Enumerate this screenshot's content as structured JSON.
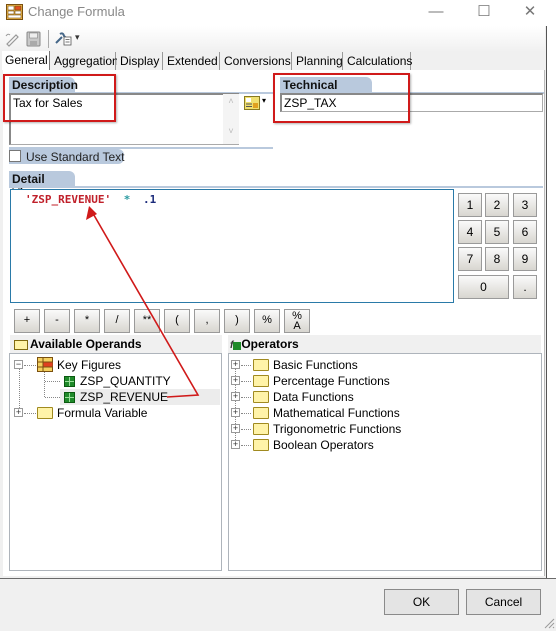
{
  "window": {
    "title": "Change Formula",
    "minimize_glyph": "—",
    "maximize_glyph": "☐",
    "close_glyph": "✕"
  },
  "toolbar": {
    "icons": [
      "edit-pencil-icon",
      "save-disk-icon",
      "tools-wrench-icon"
    ],
    "dropdown_glyph": "▾"
  },
  "tabs": [
    {
      "label": "General",
      "active": true
    },
    {
      "label": "Aggregation",
      "active": false
    },
    {
      "label": "Display",
      "active": false
    },
    {
      "label": "Extended",
      "active": false
    },
    {
      "label": "Conversions",
      "active": false
    },
    {
      "label": "Planning",
      "active": false
    },
    {
      "label": "Calculations",
      "active": false
    }
  ],
  "description": {
    "label": "Description",
    "value": "Tax for Sales",
    "scroll_up": "˄",
    "scroll_down": "˅"
  },
  "technical_name": {
    "label": "Technical Name",
    "value": "ZSP_TAX"
  },
  "use_standard_text": {
    "label": "Use Standard Text",
    "checked": false
  },
  "detail_view": {
    "label": "Detail View",
    "formula": {
      "operand": "'ZSP_REVENUE'",
      "operator": "*",
      "number": ".1"
    }
  },
  "keypad": {
    "digits": [
      "1",
      "2",
      "3",
      "4",
      "5",
      "6",
      "7",
      "8",
      "9",
      "0",
      "."
    ]
  },
  "operator_buttons": [
    "+",
    "-",
    "*",
    "/",
    "**",
    "(",
    ",",
    ")",
    "%",
    "%\nA"
  ],
  "available_operands": {
    "title": "Available Operands",
    "tree": {
      "key_figures": {
        "label": "Key Figures",
        "expanded": true,
        "children": [
          "ZSP_QUANTITY",
          "ZSP_REVENUE"
        ],
        "selected": "ZSP_REVENUE"
      },
      "formula_variable": {
        "label": "Formula Variable",
        "expanded": false
      }
    }
  },
  "operators": {
    "title": "Operators",
    "items": [
      "Basic Functions",
      "Percentage Functions",
      "Data Functions",
      "Mathematical Functions",
      "Trigonometric Functions",
      "Boolean Operators"
    ]
  },
  "buttons": {
    "ok": "OK",
    "cancel": "Cancel"
  },
  "annotation_color": "#d01a1a"
}
